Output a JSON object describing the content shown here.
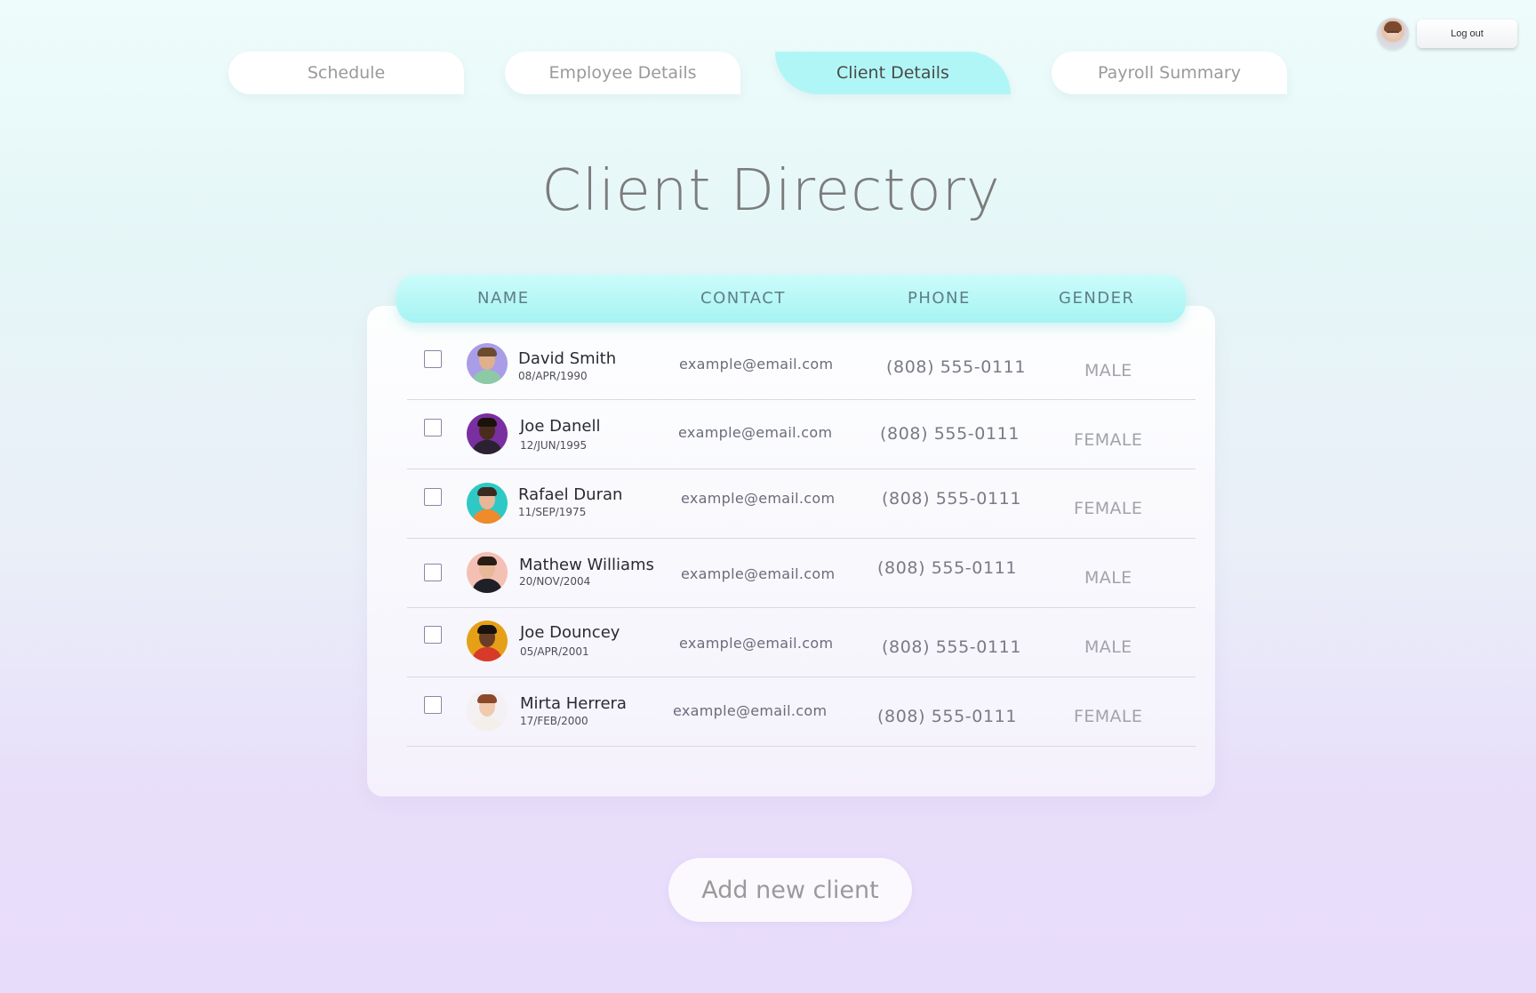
{
  "header": {
    "logout_label": "Log out"
  },
  "tabs": [
    {
      "label": "Schedule",
      "active": false
    },
    {
      "label": "Employee Details",
      "active": false
    },
    {
      "label": "Client Details",
      "active": true
    },
    {
      "label": "Payroll Summary",
      "active": false
    }
  ],
  "page_title": "Client Directory",
  "table": {
    "columns": [
      "NAME",
      "CONTACT",
      "PHONE",
      "GENDER"
    ],
    "rows": [
      {
        "name": "David Smith",
        "dob": "08/APR/1990",
        "email": "example@email.com",
        "phone": "(808) 555-0111",
        "gender": "MALE",
        "avatar_bg": "#a99de8",
        "skin": "#e0b08c",
        "hair": "#6b4a2e",
        "shirt": "#8ec9a6"
      },
      {
        "name": "Joe Danell",
        "dob": "12/JUN/1995",
        "email": "example@email.com",
        "phone": "(808) 555-0111",
        "gender": "FEMALE",
        "avatar_bg": "#7a2fa0",
        "skin": "#4a2c1e",
        "hair": "#1c120c",
        "shirt": "#2a2230"
      },
      {
        "name": "Rafael Duran",
        "dob": "11/SEP/1975",
        "email": "example@email.com",
        "phone": "(808) 555-0111",
        "gender": "FEMALE",
        "avatar_bg": "#2ec9c5",
        "skin": "#e8b79a",
        "hair": "#3a2a20",
        "shirt": "#f08a2a"
      },
      {
        "name": "Mathew Williams",
        "dob": "20/NOV/2004",
        "email": "example@email.com",
        "phone": "(808) 555-0111",
        "gender": "MALE",
        "avatar_bg": "#f5c0b4",
        "skin": "#e9b898",
        "hair": "#2a1d16",
        "shirt": "#1f1f27"
      },
      {
        "name": "Joe Douncey",
        "dob": "05/APR/2001",
        "email": "example@email.com",
        "phone": "(808) 555-0111",
        "gender": "MALE",
        "avatar_bg": "#e6a018",
        "skin": "#6a3e26",
        "hair": "#1a120d",
        "shirt": "#d83a2a"
      },
      {
        "name": "Mirta Herrera",
        "dob": "17/FEB/2000",
        "email": "example@email.com",
        "phone": "(808) 555-0111",
        "gender": "FEMALE",
        "avatar_bg": "#f4f1f4",
        "skin": "#f0c9af",
        "hair": "#8a4a2a",
        "shirt": "#f4efe9"
      }
    ]
  },
  "add_button_label": "Add new client",
  "colors": {
    "accent": "#b1f6f6",
    "header_bar": "#a6f3f3",
    "background_top": "#eefcfb",
    "background_bottom": "#e8dcfb"
  },
  "icons": {
    "checkbox": "checkbox-icon",
    "user_avatar": "avatar-icon"
  }
}
